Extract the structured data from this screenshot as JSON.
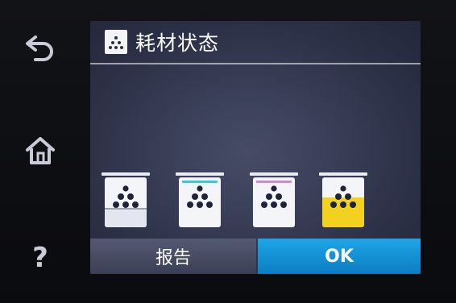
{
  "screen": {
    "title": "耗材状态"
  },
  "hardware_keys": [
    "back-icon",
    "home-icon",
    "help-icon"
  ],
  "help_key_label": "?",
  "cartridges": [
    {
      "ink": "black",
      "accent": "#1f2333",
      "level": 0.35
    },
    {
      "ink": "cyan",
      "accent": "#3ac8d8",
      "level": 0.0
    },
    {
      "ink": "magenta",
      "accent": "#d08ad0",
      "level": 0.0
    },
    {
      "ink": "yellow",
      "accent": "#f2d21e",
      "level": 0.6
    }
  ],
  "buttons": {
    "report_label": "报告",
    "ok_label": "OK"
  },
  "colors": {
    "ok_button": "#1496dc",
    "screen_background": "#3a3f58"
  }
}
